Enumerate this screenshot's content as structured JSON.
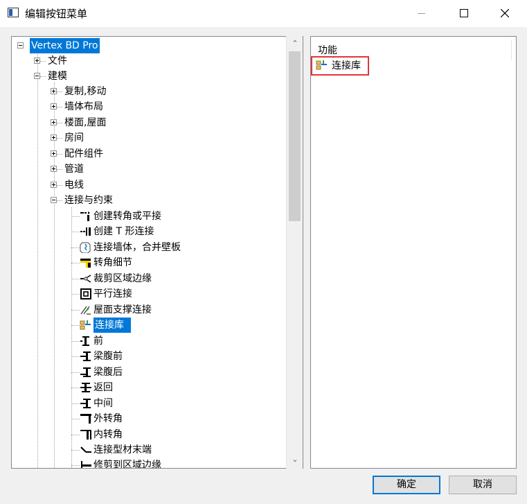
{
  "window": {
    "title": "编辑按钮菜单"
  },
  "tree": {
    "root": "Vertex BD Pro",
    "items": [
      {
        "label": "文件",
        "icon": "plus-expander"
      },
      {
        "label": "建模",
        "icon": "minus-expander"
      },
      {
        "label": "复制,移动",
        "icon": "plus-expander"
      },
      {
        "label": "墙体布局",
        "icon": "plus-expander"
      },
      {
        "label": "楼面,屋面",
        "icon": "plus-expander"
      },
      {
        "label": "房间",
        "icon": "plus-expander"
      },
      {
        "label": "配件组件",
        "icon": "plus-expander"
      },
      {
        "label": "管道",
        "icon": "plus-expander"
      },
      {
        "label": "电线",
        "icon": "plus-expander"
      },
      {
        "label": "连接与约束",
        "icon": "minus-expander"
      },
      {
        "label": "创建转角或平接",
        "icon": "corner-join-icon"
      },
      {
        "label": "创建 T 形连接",
        "icon": "t-join-icon"
      },
      {
        "label": "连接墙体，合并壁板",
        "icon": "wall-connect-icon"
      },
      {
        "label": "转角细节",
        "icon": "corner-detail-icon"
      },
      {
        "label": "裁剪区域边缘",
        "icon": "trim-edge-icon"
      },
      {
        "label": "平行连接",
        "icon": "parallel-join-icon"
      },
      {
        "label": "屋面支撑连接",
        "icon": "roof-support-icon"
      },
      {
        "label": "连接库",
        "icon": "connection-library-icon"
      },
      {
        "label": "前",
        "icon": "front-icon"
      },
      {
        "label": "梁腹前",
        "icon": "web-front-icon"
      },
      {
        "label": "梁腹后",
        "icon": "web-back-icon"
      },
      {
        "label": "返回",
        "icon": "back-icon"
      },
      {
        "label": "中间",
        "icon": "middle-icon"
      },
      {
        "label": "外转角",
        "icon": "outer-corner-icon"
      },
      {
        "label": "内转角",
        "icon": "inner-corner-icon"
      },
      {
        "label": "连接型材末端",
        "icon": "profile-end-icon"
      },
      {
        "label": "修剪到区域边缘",
        "icon": "trim-to-edge-icon"
      }
    ]
  },
  "list": {
    "header": "功能",
    "items": [
      {
        "label": "连接库",
        "icon": "connection-library-icon"
      }
    ]
  },
  "buttons": {
    "ok": "确定",
    "cancel": "取消"
  }
}
